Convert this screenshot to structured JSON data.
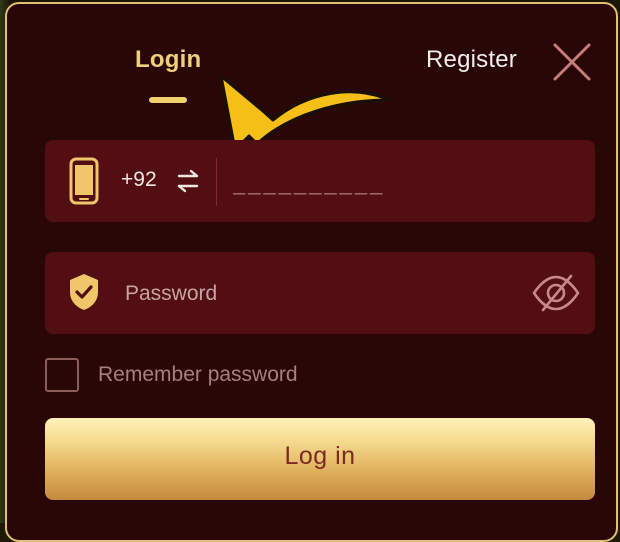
{
  "tabs": {
    "login": "Login",
    "register": "Register"
  },
  "phone": {
    "country_code": "+92",
    "placeholder": "__________"
  },
  "password": {
    "placeholder": "Password"
  },
  "remember": {
    "label": "Remember password",
    "checked": false
  },
  "submit": {
    "label": "Log in"
  },
  "icons": {
    "close": "close-icon",
    "phone": "phone-icon",
    "swap": "swap-arrows-icon",
    "shield": "shield-check-icon",
    "eye": "eye-slash-icon",
    "arrow": "pointer-arrow-icon"
  },
  "colors": {
    "panel_bg": "#2a0707",
    "border_gold": "#e2bf72",
    "field_bg": "#520e12",
    "accent_gold": "#f1d06e",
    "button_text": "#7a2a22"
  }
}
